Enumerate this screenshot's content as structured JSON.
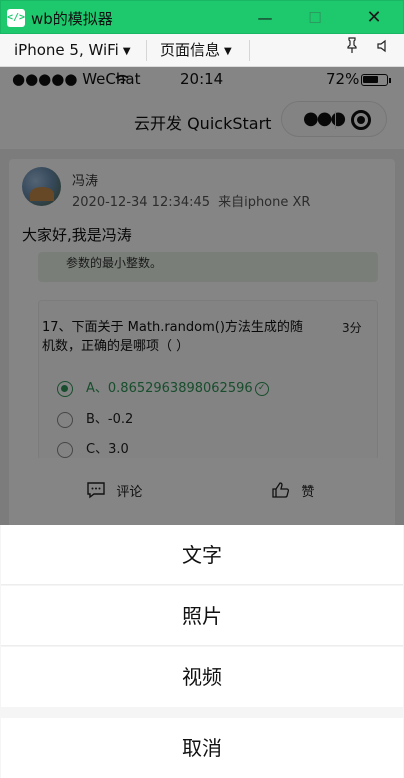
{
  "window": {
    "title": "wb的模拟器",
    "min_glyph": "—",
    "max_glyph": "☐",
    "close_glyph": "✕"
  },
  "toolbar": {
    "device": "iPhone 5, WiFi",
    "page_info": "页面信息"
  },
  "statusbar": {
    "carrier": "●●●●● WeChat",
    "time": "20:14",
    "battery": "72%",
    "battery_level": 0.72
  },
  "navbar": {
    "title": "云开发 QuickStart"
  },
  "post": {
    "author": "冯涛",
    "datetime": "2020-12-34 12:34:45",
    "source": "来自iphone XR",
    "text": "大家好,我是冯涛",
    "quiz_prev_text": "参数的最小整数。",
    "question": "17、下面关于 Math.random()方法生成的随机数，正确的是哪项（ ）",
    "score": "3分",
    "options": [
      {
        "label": "A、0.8652963898062596",
        "selected": true
      },
      {
        "label": "B、-0.2",
        "selected": false
      },
      {
        "label": "C、3.0",
        "selected": false
      }
    ],
    "comment_label": "评论",
    "like_label": "赞"
  },
  "action_sheet": {
    "items": [
      "文字",
      "照片",
      "视频"
    ],
    "cancel": "取消"
  },
  "colors": {
    "titlebar": "#1ec96e",
    "accent_green": "#2e9556"
  }
}
